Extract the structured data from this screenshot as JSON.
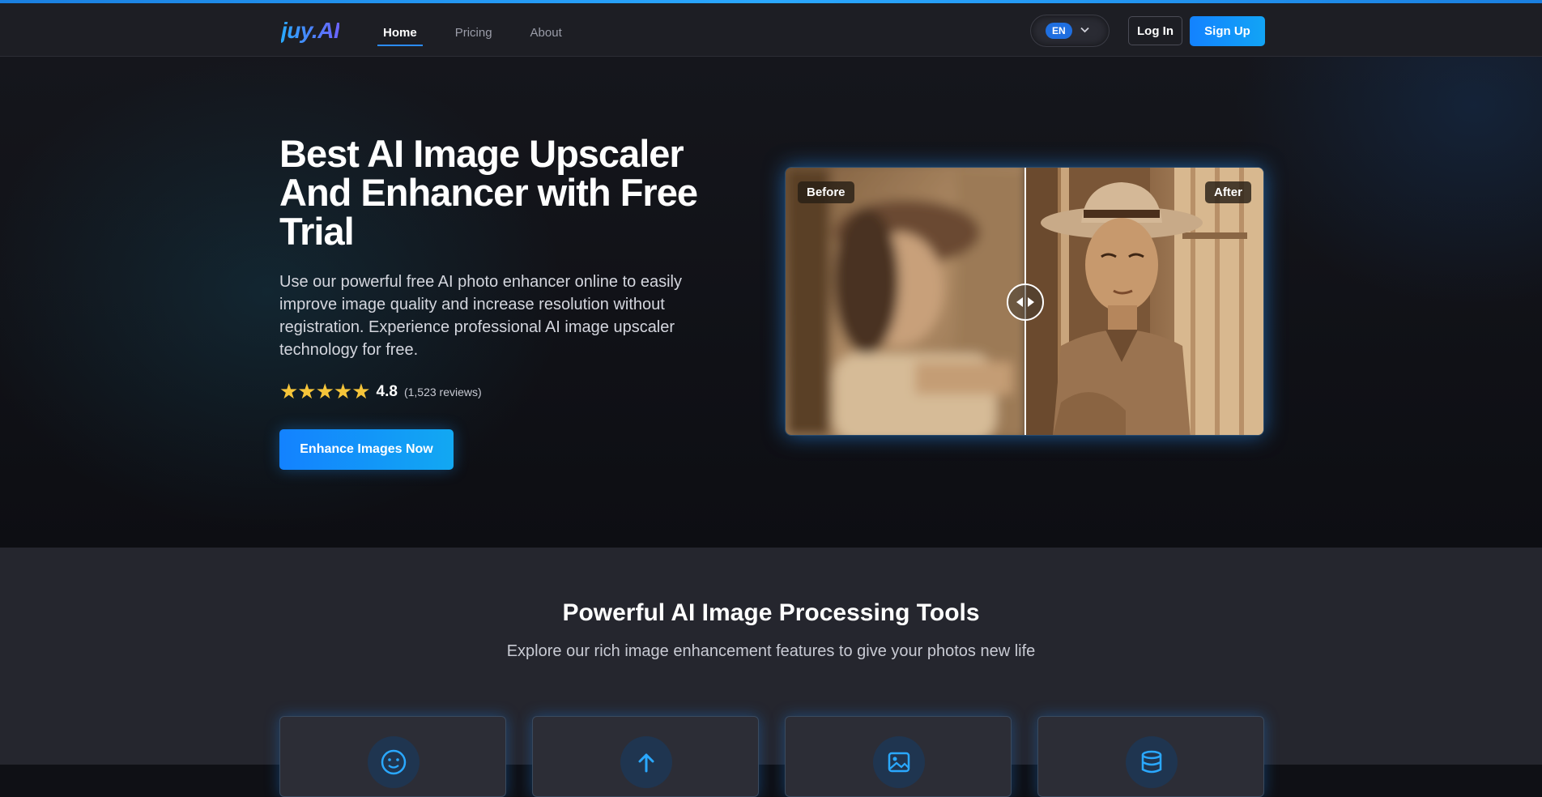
{
  "brand": {
    "logo_text": "juy.AI",
    "accent": "#1382ff"
  },
  "nav": {
    "items": [
      {
        "label": "Home",
        "active": true
      },
      {
        "label": "Pricing",
        "active": false
      },
      {
        "label": "About",
        "active": false
      }
    ]
  },
  "header": {
    "language": "EN",
    "login_label": "Log In",
    "signup_label": "Sign Up"
  },
  "hero": {
    "title": "Best AI Image Upscaler And Enhancer with Free Trial",
    "description": "Use our powerful free AI photo enhancer online to easily improve image quality and increase resolution without registration. Experience professional AI image upscaler technology for free.",
    "stars": "★★★★★",
    "rating_value": "4.8",
    "rating_count": "(1,523 reviews)",
    "cta_label": "Enhance Images Now"
  },
  "compare": {
    "before_label": "Before",
    "after_label": "After"
  },
  "tools": {
    "title": "Powerful AI Image Processing Tools",
    "subtitle": "Explore our rich image enhancement features to give your photos new life",
    "cards": [
      {
        "icon": "face-icon"
      },
      {
        "icon": "upload-arrow-icon"
      },
      {
        "icon": "image-icon"
      },
      {
        "icon": "database-icon"
      }
    ]
  }
}
